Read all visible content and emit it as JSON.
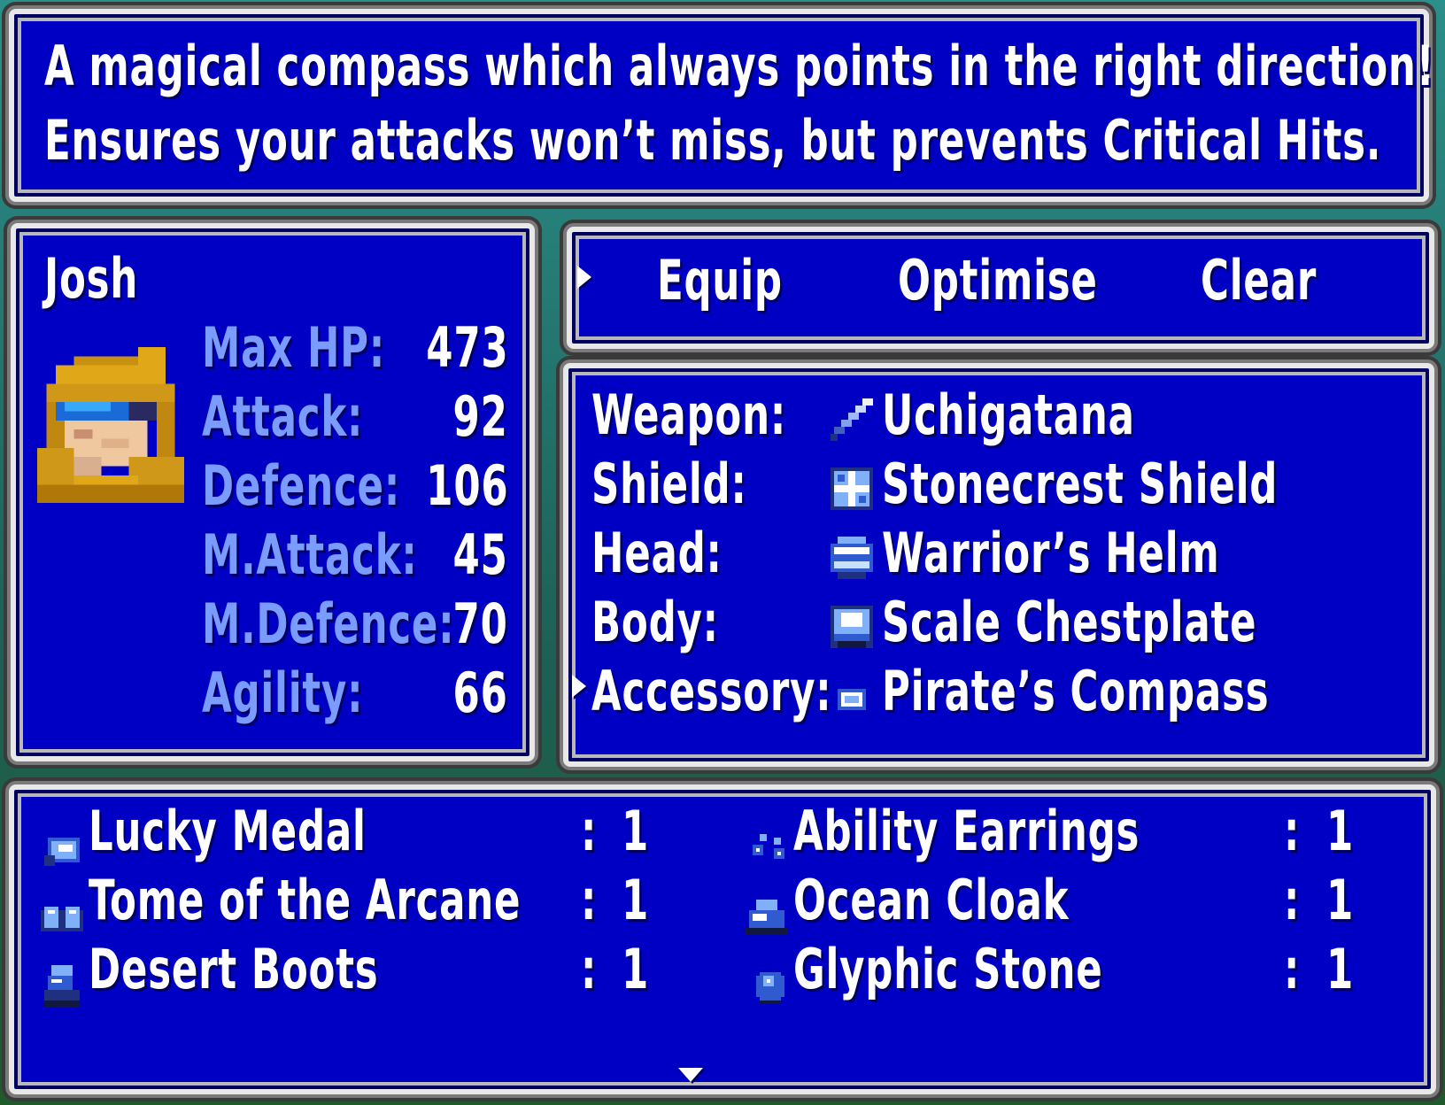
{
  "description": {
    "line1": "A magical compass which always points in the right direction!",
    "line2": "Ensures your attacks won’t miss, but prevents Critical Hits."
  },
  "character": {
    "name": "Josh",
    "portrait": "hooded-warrior-portrait",
    "stats": [
      {
        "label": "Max HP:",
        "value": "473"
      },
      {
        "label": "Attack:",
        "value": "92"
      },
      {
        "label": "Defence:",
        "value": "106"
      },
      {
        "label": "M.Attack:",
        "value": "45"
      },
      {
        "label": "M.Defence:",
        "value": "70"
      },
      {
        "label": "Agility:",
        "value": "66"
      }
    ]
  },
  "commands": {
    "equip": "Equip",
    "optimise": "Optimise",
    "clear": "Clear"
  },
  "equipment": [
    {
      "slot": "Weapon:",
      "icon": "sword-icon",
      "item": "Uchigatana"
    },
    {
      "slot": "Shield:",
      "icon": "shield-icon",
      "item": "Stonecrest Shield"
    },
    {
      "slot": "Head:",
      "icon": "helm-icon",
      "item": "Warrior’s Helm"
    },
    {
      "slot": "Body:",
      "icon": "armor-icon",
      "item": "Scale Chestplate"
    },
    {
      "slot": "Accessory:",
      "icon": "compass-icon",
      "item": "Pirate’s Compass"
    }
  ],
  "inventory": [
    {
      "icon": "medal-icon",
      "name": "Lucky Medal",
      "count": "1"
    },
    {
      "icon": "earrings-icon",
      "name": "Ability Earrings",
      "count": "1"
    },
    {
      "icon": "tome-icon",
      "name": "Tome of the Arcane",
      "count": "1"
    },
    {
      "icon": "cloak-icon",
      "name": "Ocean Cloak",
      "count": "1"
    },
    {
      "icon": "boots-icon",
      "name": "Desert Boots",
      "count": "1"
    },
    {
      "icon": "stone-icon",
      "name": "Glyphic Stone",
      "count": "1"
    }
  ],
  "colors": {
    "window": "#0000c4",
    "border": "#e8e8e8",
    "stat_label": "#7b9cff",
    "text": "#ffffff"
  }
}
